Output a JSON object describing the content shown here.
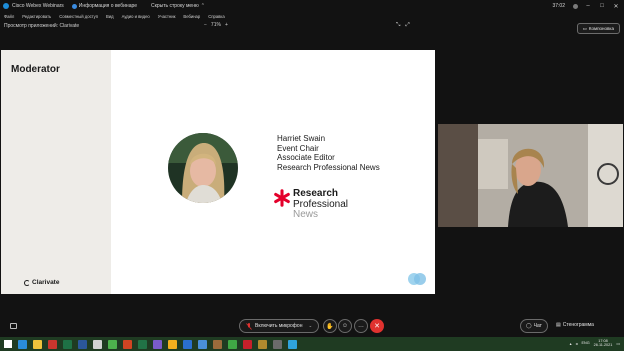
{
  "window": {
    "app_name": "Cisco Webex Webinars",
    "info_label": "Информация о вебинаре",
    "hide_bar_label": "Скрыть строку меню",
    "time": "37:02"
  },
  "menu": [
    "Файл",
    "Редактировать",
    "Совместный доступ",
    "Вид",
    "Аудио и видео",
    "Участник",
    "Вебинар",
    "Справка"
  ],
  "toolbar": {
    "share_title": "Просмотр приложений: Clarivate",
    "zoom_out": "−",
    "zoom_level": "71%",
    "zoom_in": "+",
    "layout_button": "Компоновка"
  },
  "slide": {
    "heading": "Moderator",
    "speaker_name": "Harriet Swain",
    "speaker_role1": "Event Chair",
    "speaker_role2": "Associate Editor",
    "speaker_org": "Research Professional News",
    "logo_line1": "Research",
    "logo_line2": "Professional",
    "logo_line3": "News",
    "brand": "Clarivate"
  },
  "controls": {
    "mic_label": "Включить микрофон",
    "chat_label": "Чат",
    "steno_label": "Стенограмма"
  },
  "taskbar": {
    "lang": "ENG",
    "time": "17:08",
    "date": "26.11.2021"
  },
  "colors": {
    "end_call": "#e0322f",
    "rp_red": "#e4002b",
    "taskbar": "#1f3b22"
  }
}
